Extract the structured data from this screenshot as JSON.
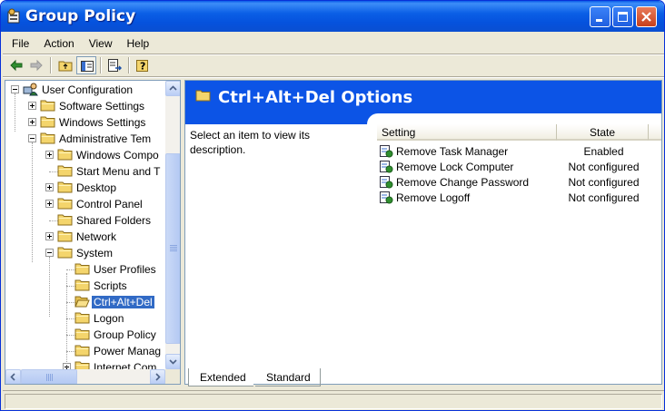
{
  "window": {
    "title": "Group Policy",
    "accent": "#0c54e6",
    "selection_color": "#316ac5"
  },
  "menu": [
    "File",
    "Action",
    "View",
    "Help"
  ],
  "toolbar": {
    "icons": [
      "back-arrow-icon",
      "forward-arrow-icon",
      "up-folder-icon",
      "show-hide-tree-icon",
      "export-list-icon",
      "help-icon"
    ]
  },
  "tree": {
    "items": [
      {
        "label": "User Configuration",
        "level": 0,
        "expander": "minus",
        "icon": "computer-user-icon"
      },
      {
        "label": "Software Settings",
        "level": 1,
        "expander": "plus",
        "icon": "folder-icon"
      },
      {
        "label": "Windows Settings",
        "level": 1,
        "expander": "plus",
        "icon": "folder-icon"
      },
      {
        "label": "Administrative Tem",
        "level": 1,
        "expander": "minus",
        "icon": "folder-icon"
      },
      {
        "label": "Windows Compo",
        "level": 2,
        "expander": "plus",
        "icon": "folder-icon"
      },
      {
        "label": "Start Menu and T",
        "level": 2,
        "expander": "none",
        "icon": "folder-icon"
      },
      {
        "label": "Desktop",
        "level": 2,
        "expander": "plus",
        "icon": "folder-icon"
      },
      {
        "label": "Control Panel",
        "level": 2,
        "expander": "plus",
        "icon": "folder-icon"
      },
      {
        "label": "Shared Folders",
        "level": 2,
        "expander": "none",
        "icon": "folder-icon"
      },
      {
        "label": "Network",
        "level": 2,
        "expander": "plus",
        "icon": "folder-icon"
      },
      {
        "label": "System",
        "level": 2,
        "expander": "minus",
        "icon": "folder-icon"
      },
      {
        "label": "User Profiles",
        "level": 3,
        "expander": "none",
        "icon": "folder-icon"
      },
      {
        "label": "Scripts",
        "level": 3,
        "expander": "none",
        "icon": "folder-icon"
      },
      {
        "label": "Ctrl+Alt+Del",
        "level": 3,
        "expander": "none",
        "icon": "open-folder-icon",
        "selected": true
      },
      {
        "label": "Logon",
        "level": 3,
        "expander": "none",
        "icon": "folder-icon"
      },
      {
        "label": "Group Policy",
        "level": 3,
        "expander": "none",
        "icon": "folder-icon"
      },
      {
        "label": "Power Manag",
        "level": 3,
        "expander": "none",
        "icon": "folder-icon"
      },
      {
        "label": "Internet Com",
        "level": 3,
        "expander": "plus",
        "icon": "folder-icon"
      }
    ]
  },
  "details": {
    "title": "Ctrl+Alt+Del Options",
    "description": "Select an item to view its description.",
    "columns": [
      "Setting",
      "State"
    ],
    "rows": [
      {
        "setting": "Remove Task Manager",
        "state": "Enabled"
      },
      {
        "setting": "Remove Lock Computer",
        "state": "Not configured"
      },
      {
        "setting": "Remove Change Password",
        "state": "Not configured"
      },
      {
        "setting": "Remove Logoff",
        "state": "Not configured"
      }
    ]
  },
  "tabs": [
    {
      "label": "Extended",
      "active": true
    },
    {
      "label": "Standard",
      "active": false
    }
  ]
}
